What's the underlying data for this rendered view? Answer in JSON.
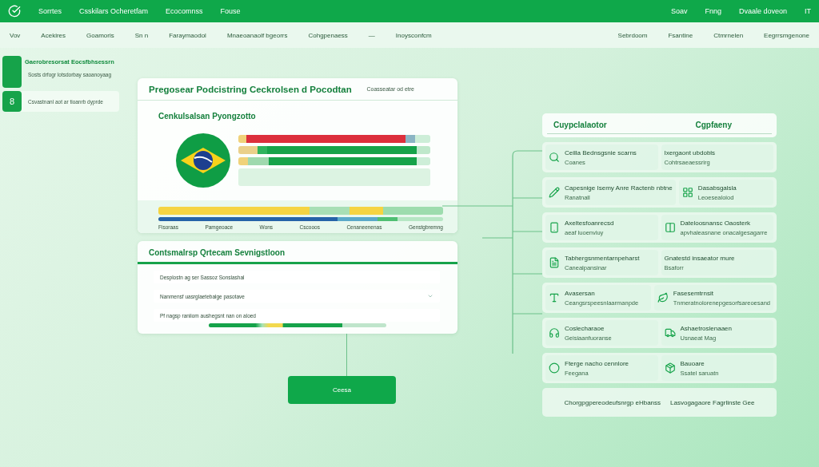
{
  "top_bar": {
    "nav": [
      "Sorrtes",
      "Csskilars Ocheretfam",
      "Ecocomnss",
      "Fouse"
    ],
    "right": [
      "Soav",
      "Fnng",
      "Dvaale doveon",
      "IT"
    ]
  },
  "sub_nav": {
    "left": [
      "Vov",
      "Acekires",
      "Goamoris",
      "Sn n",
      "Faraymaodol",
      "Mnaeoanaolf bgeorrs",
      "Cohgpenaess",
      "—",
      "Inoysconfcm"
    ],
    "right": [
      "Sebrdoom",
      "Fsantine",
      "Ctmrnelen",
      "Eegrrsmgenone"
    ]
  },
  "steps": [
    {
      "title": "Gaerobresorsat Eocsfbhsessrn",
      "text": "Sosts drfogr lotsdorbay saoanoyaag",
      "selected": false
    },
    {
      "badge": "8",
      "text": "Csvastnanl aot ar tioanrb dyprde",
      "selected": true
    }
  ],
  "main_card": {
    "title": "Pregosear Podcistring Ceckrolsen d Pocodtan",
    "aside": "Coasseatar od etre",
    "subtitle": "Cenkulsalsan Pyongzotto",
    "axis_labels": [
      "Fisoraas",
      "Pamgeoace",
      "Wons",
      "Cscooos",
      "Cenaneenenas",
      "Genstgbremng"
    ]
  },
  "config_card": {
    "title": "Contsmalrsp Qrtecam Sevnigstloon",
    "rows": [
      {
        "kind": "text",
        "value": "Desplostn ag ser Sassoz Sonslashal"
      },
      {
        "kind": "select",
        "value": "Nanmensf uasrglaetebalge pasotave"
      },
      {
        "kind": "text",
        "value": "Pf nagsp raniiom aushegsnt nan on aloed"
      }
    ],
    "progress": {
      "level": 0.75
    }
  },
  "action_button": "Ceesa",
  "panel": {
    "headers": [
      "Cuypclalaotor",
      "Cgpfaeny"
    ],
    "rows": [
      [
        {
          "title": "Ceilla Bednsgsnie scarns",
          "text": "Coanes"
        },
        {
          "title": "Ixergaont ubdobls",
          "text": "Cohtrsaeaessrirg"
        }
      ],
      [
        {
          "title": "Capesnige Isemy Anre Ractenb nbtne",
          "text": "Ranatnall"
        },
        {
          "title": "Dasabsgalsla",
          "text": "Leoesealoiod"
        }
      ],
      [
        {
          "title": "Axeltesfoanrecsd",
          "text": "aeaf luoenviuy"
        },
        {
          "title": "Dateloosnansc Oaosterk",
          "text": "apvhaleasnane onacalgesagarre"
        }
      ],
      [
        {
          "title": "Tabhergsnmentarnpeharst",
          "text": "Canealpansinar"
        },
        {
          "title": "Gnatestd insaeator mure",
          "text": "Bsaforr"
        }
      ],
      [
        {
          "title": "Avasersan",
          "text": "Ceangsrspeesnlaarmanpde"
        },
        {
          "title": "Fasesemtrnsit",
          "text": "Tnmeratnolorenepgesorfsareoesand"
        }
      ],
      [
        {
          "title": "Coslecharaoe",
          "text": "Geisiaanfuoranse"
        },
        {
          "title": "Ashaetroslenaaen",
          "text": "Usnaeat Mag"
        }
      ],
      [
        {
          "title": "Fterge nacho cennlore",
          "text": "Feegana"
        },
        {
          "title": "Bauoare",
          "text": "Ssatel saruatn"
        }
      ]
    ],
    "footer": [
      "Chorgpgpereodeufsnrgp eHbanss",
      "Lasvogagaore Fagrlinste Gee"
    ]
  }
}
